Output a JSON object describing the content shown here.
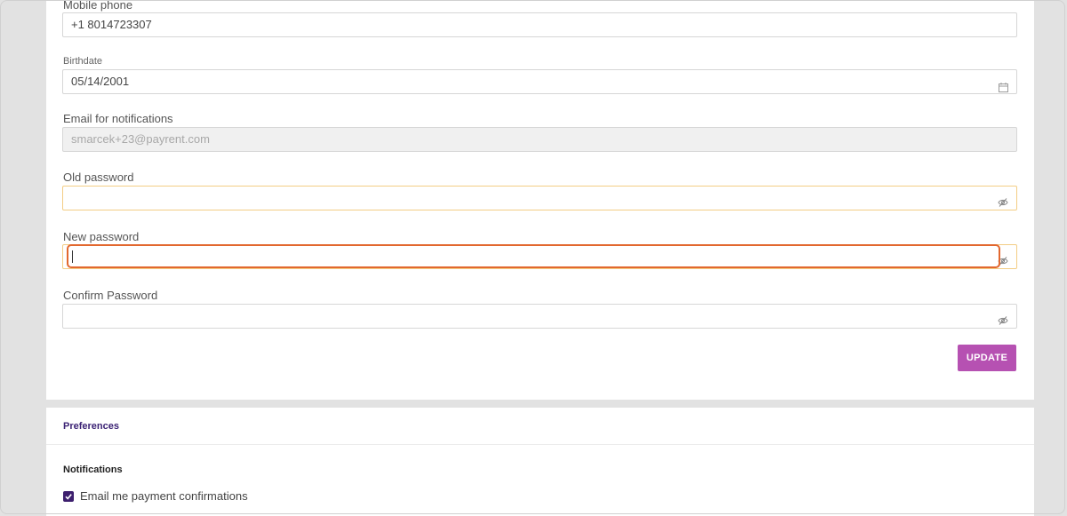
{
  "profile": {
    "mobile_phone": {
      "label": "Mobile phone",
      "value": "+1 8014723307"
    },
    "birthdate": {
      "label": "Birthdate",
      "value": "05/14/2001",
      "icon": "calendar-icon"
    },
    "email_notifications": {
      "label": "Email for notifications",
      "value": "smarcek+23@payrent.com"
    },
    "old_password": {
      "label": "Old password",
      "value": "",
      "icon": "eye-slash-icon"
    },
    "new_password": {
      "label": "New password",
      "value": "",
      "icon": "eye-slash-icon"
    },
    "confirm_password": {
      "label": "Confirm Password",
      "value": "",
      "icon": "eye-slash-icon"
    },
    "update_label": "UPDATE"
  },
  "preferences": {
    "title": "Preferences",
    "notifications_heading": "Notifications",
    "options": [
      {
        "label": "Email me payment confirmations",
        "checked": true
      }
    ]
  },
  "colors": {
    "accent": "#b651b2",
    "brand_dark": "#3d1f6e",
    "focus": "#e2682f",
    "warning_border": "#f3cd84"
  }
}
